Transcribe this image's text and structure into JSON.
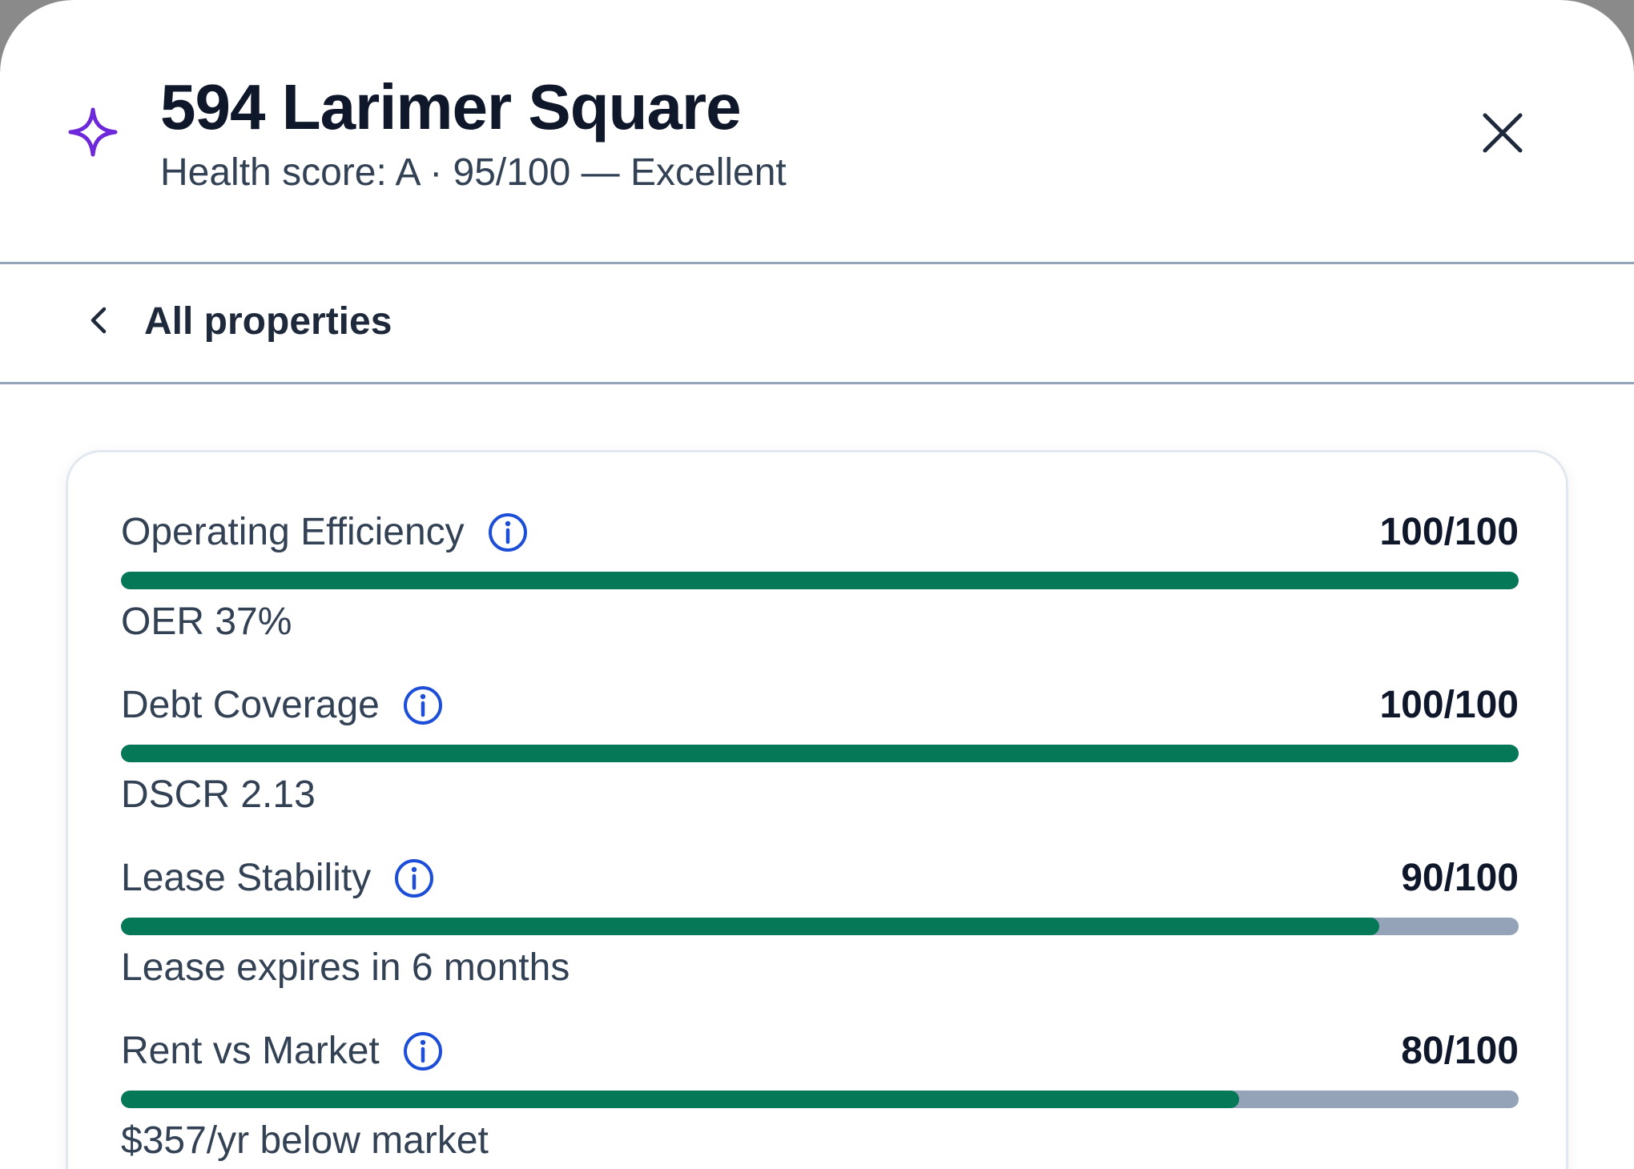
{
  "header": {
    "title": "594 Larimer Square",
    "subtitle": "Health score: A · 95/100 — Excellent",
    "icons": {
      "brand": "sparkle-icon",
      "close": "close-icon"
    },
    "accent_color": "#6d28d9"
  },
  "nav": {
    "back_label": "All properties",
    "back_icon": "chevron-left-icon"
  },
  "metrics": [
    {
      "label": "Operating Efficiency",
      "score": "100/100",
      "value": 100,
      "detail": "OER 37%"
    },
    {
      "label": "Debt Coverage",
      "score": "100/100",
      "value": 100,
      "detail": "DSCR 2.13"
    },
    {
      "label": "Lease Stability",
      "score": "90/100",
      "value": 90,
      "detail": "Lease expires in 6 months"
    },
    {
      "label": "Rent vs Market",
      "score": "80/100",
      "value": 80,
      "detail": "$357/yr below market"
    }
  ],
  "colors": {
    "bar_fill": "#047857",
    "bar_track": "#94a3b8",
    "info_icon": "#1d4ed8"
  }
}
